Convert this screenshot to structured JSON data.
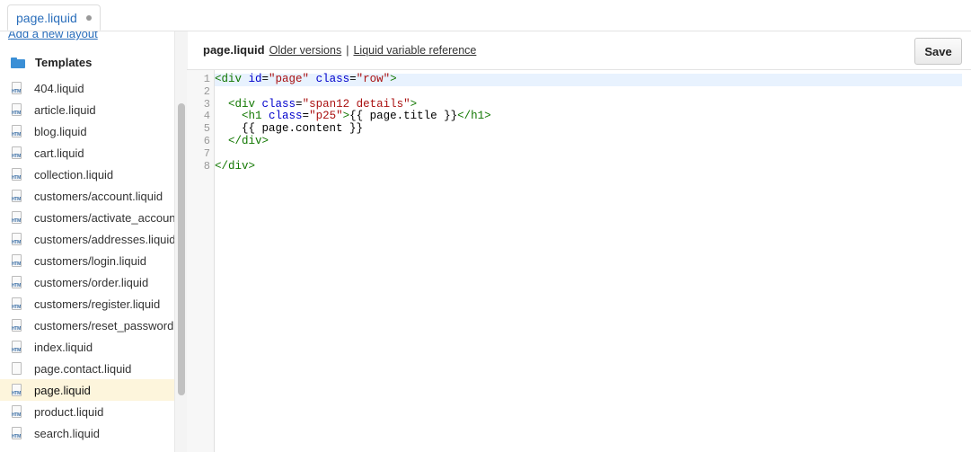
{
  "tab": {
    "label": "page.liquid",
    "modified_dot": true
  },
  "sidebar": {
    "add_layout_link": "Add a new layout",
    "section_title": "Templates",
    "items": [
      {
        "label": "404.liquid",
        "icon": "htm-file"
      },
      {
        "label": "article.liquid",
        "icon": "htm-file"
      },
      {
        "label": "blog.liquid",
        "icon": "htm-file"
      },
      {
        "label": "cart.liquid",
        "icon": "htm-file"
      },
      {
        "label": "collection.liquid",
        "icon": "htm-file"
      },
      {
        "label": "customers/account.liquid",
        "icon": "htm-file"
      },
      {
        "label": "customers/activate_account.liquid",
        "icon": "htm-file"
      },
      {
        "label": "customers/addresses.liquid",
        "icon": "htm-file"
      },
      {
        "label": "customers/login.liquid",
        "icon": "htm-file"
      },
      {
        "label": "customers/order.liquid",
        "icon": "htm-file"
      },
      {
        "label": "customers/register.liquid",
        "icon": "htm-file"
      },
      {
        "label": "customers/reset_password.liquid",
        "icon": "htm-file"
      },
      {
        "label": "index.liquid",
        "icon": "htm-file"
      },
      {
        "label": "page.contact.liquid",
        "icon": "blank-file"
      },
      {
        "label": "page.liquid",
        "icon": "htm-file",
        "active": true
      },
      {
        "label": "product.liquid",
        "icon": "htm-file"
      },
      {
        "label": "search.liquid",
        "icon": "htm-file"
      }
    ]
  },
  "header": {
    "filename": "page.liquid",
    "older_versions": "Older versions",
    "separator": "|",
    "variable_reference": "Liquid variable reference",
    "save_label": "Save"
  },
  "editor": {
    "lines": [
      {
        "n": "1",
        "tokens": [
          [
            "t",
            "<div "
          ],
          [
            "a",
            "id"
          ],
          [
            "p",
            "="
          ],
          [
            "s",
            "\"page\""
          ],
          [
            "p",
            " "
          ],
          [
            "a",
            "class"
          ],
          [
            "p",
            "="
          ],
          [
            "s",
            "\"row\""
          ],
          [
            "t",
            ">"
          ]
        ]
      },
      {
        "n": "2",
        "tokens": []
      },
      {
        "n": "3",
        "tokens": [
          [
            "p",
            "  "
          ],
          [
            "t",
            "<div "
          ],
          [
            "a",
            "class"
          ],
          [
            "p",
            "="
          ],
          [
            "s",
            "\"span12 details\""
          ],
          [
            "t",
            ">"
          ]
        ]
      },
      {
        "n": "4",
        "tokens": [
          [
            "p",
            "    "
          ],
          [
            "t",
            "<h1 "
          ],
          [
            "a",
            "class"
          ],
          [
            "p",
            "="
          ],
          [
            "s",
            "\"p25\""
          ],
          [
            "t",
            ">"
          ],
          [
            "p",
            "{{ page.title }}"
          ],
          [
            "t",
            "</h1>"
          ]
        ]
      },
      {
        "n": "5",
        "tokens": [
          [
            "p",
            "    {{ page.content }}"
          ]
        ]
      },
      {
        "n": "6",
        "tokens": [
          [
            "p",
            "  "
          ],
          [
            "t",
            "</div>"
          ]
        ]
      },
      {
        "n": "7",
        "tokens": []
      },
      {
        "n": "8",
        "tokens": [
          [
            "t",
            "</div>"
          ]
        ]
      }
    ]
  }
}
